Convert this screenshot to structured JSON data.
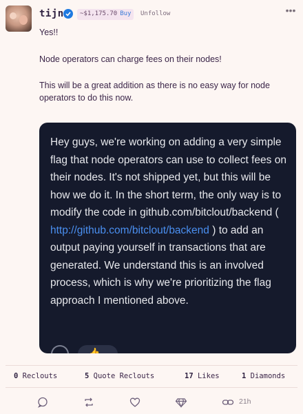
{
  "header": {
    "username": "tijn",
    "price": "~$1,175.70",
    "buy_label": "Buy",
    "unfollow_label": "Unfollow",
    "more_icon": "ellipsis-icon"
  },
  "post": {
    "line1": "Yes!!",
    "line2": "Node operators can charge fees on their nodes!",
    "line3": "This will be a great addition as there is no easy way for node operators to do this now."
  },
  "embed": {
    "text_before": "Hey guys, we're working on adding a very simple flag that node operators can use to collect fees on their nodes. It's not shipped yet, but this will be how we do it. In the short term, the only way is to modify the code in github.com/bitclout/backend ( ",
    "link": "http://github.com/bitclout/backend",
    "text_after": " ) to add an output paying yourself in transactions that are generated. We understand this is an involved process, which is why we're prioritizing the flag approach I mentioned above."
  },
  "stats": {
    "reclouts_count": "0",
    "reclouts_label": "Reclouts",
    "quote_count": "5",
    "quote_label": "Quote Reclouts",
    "likes_count": "17",
    "likes_label": "Likes",
    "diamonds_count": "1",
    "diamonds_label": "Diamonds"
  },
  "actions": {
    "time": "21h"
  },
  "colors": {
    "background": "#fdf6f3",
    "accent_link": "#4a8ff0",
    "verified": "#1f7ae0"
  }
}
